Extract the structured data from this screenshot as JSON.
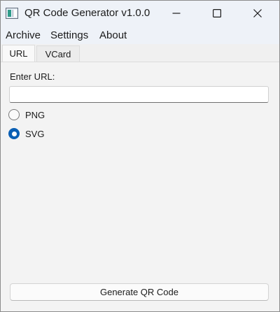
{
  "window": {
    "title": "QR Code Generator v1.0.0",
    "controls": {
      "minimize": "minimize-icon",
      "maximize": "maximize-icon",
      "close": "close-icon"
    }
  },
  "menu": {
    "items": [
      {
        "label": "Archive"
      },
      {
        "label": "Settings"
      },
      {
        "label": "About"
      }
    ]
  },
  "tabs": [
    {
      "label": "URL",
      "active": true
    },
    {
      "label": "VCard",
      "active": false
    }
  ],
  "form": {
    "url_label": "Enter URL:",
    "url_value": "",
    "url_placeholder": ""
  },
  "format_options": [
    {
      "label": "PNG",
      "checked": false
    },
    {
      "label": "SVG",
      "checked": true
    }
  ],
  "actions": {
    "generate_label": "Generate QR Code"
  },
  "colors": {
    "accent": "#0a5fb4",
    "titlebar": "#eef2f8",
    "window_bg": "#f3f3f3"
  }
}
